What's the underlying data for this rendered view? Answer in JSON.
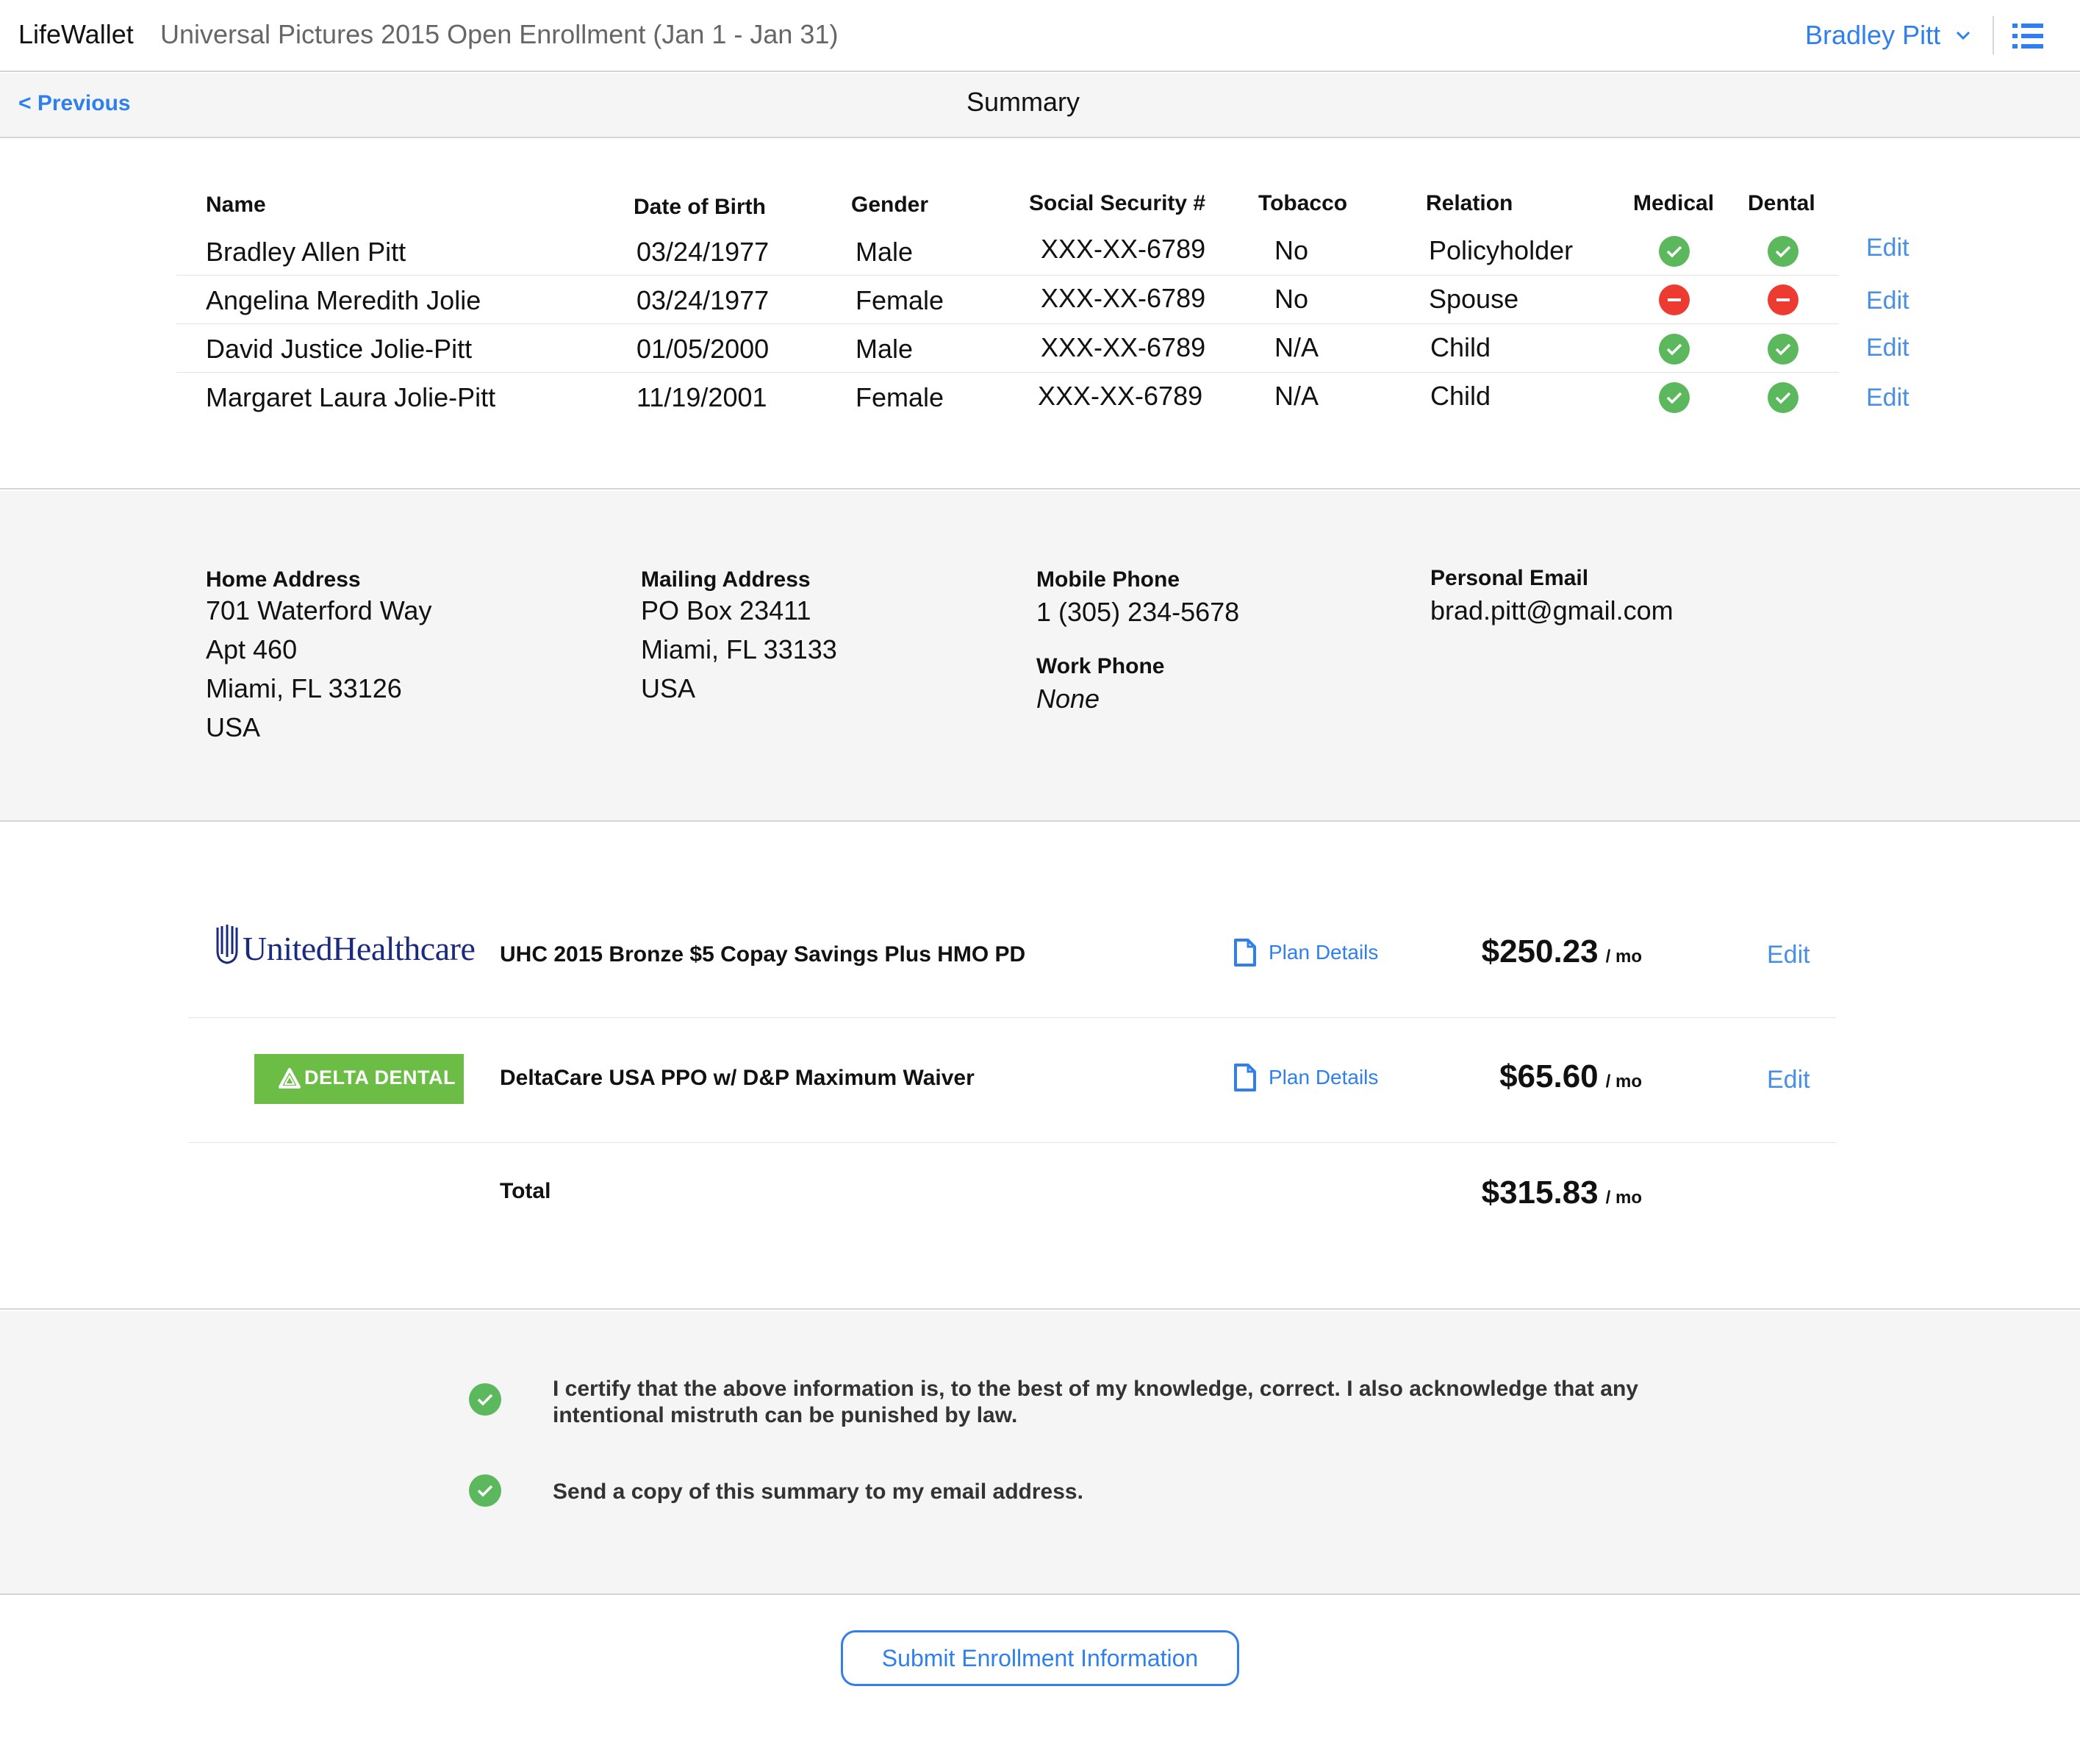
{
  "header": {
    "app_name": "LifeWallet",
    "enrollment_title": "Universal Pictures 2015 Open Enrollment (Jan 1 - Jan 31)",
    "user_name": "Bradley Pitt",
    "icons": [
      "chevron-down-icon",
      "list-menu-icon"
    ]
  },
  "nav": {
    "previous_label": "< Previous",
    "page_title": "Summary"
  },
  "family": {
    "columns": [
      "Name",
      "Date of Birth",
      "Gender",
      "Social Security #",
      "Tobacco",
      "Relation",
      "Medical",
      "Dental"
    ],
    "edit_label": "Edit",
    "members": [
      {
        "name": "Bradley Allen Pitt",
        "dob": "03/24/1977",
        "gender": "Male",
        "ssn": "XXX-XX-6789",
        "tobacco": "No",
        "relation": "Policyholder",
        "medical": "enrolled",
        "dental": "enrolled"
      },
      {
        "name": "Angelina Meredith Jolie",
        "dob": "03/24/1977",
        "gender": "Female",
        "ssn": "XXX-XX-6789",
        "tobacco": "No",
        "relation": "Spouse",
        "medical": "declined",
        "dental": "declined"
      },
      {
        "name": "David Justice Jolie-Pitt",
        "dob": "01/05/2000",
        "gender": "Male",
        "ssn": "XXX-XX-6789",
        "tobacco": "N/A",
        "relation": "Child",
        "medical": "enrolled",
        "dental": "enrolled"
      },
      {
        "name": "Margaret Laura Jolie-Pitt",
        "dob": "11/19/2001",
        "gender": "Female",
        "ssn": "XXX-XX-6789",
        "tobacco": "N/A",
        "relation": "Child",
        "medical": "enrolled",
        "dental": "enrolled"
      }
    ],
    "status_colors": {
      "enrolled": "#5cb85c",
      "declined": "#ee3b32"
    }
  },
  "contact": {
    "home_address": {
      "label": "Home Address",
      "lines": [
        "701 Waterford Way",
        "Apt 460",
        "Miami, FL 33126",
        "USA"
      ]
    },
    "mailing_address": {
      "label": "Mailing Address",
      "lines": [
        "PO Box 23411",
        "Miami, FL 33133",
        "USA"
      ]
    },
    "mobile_phone": {
      "label": "Mobile Phone",
      "value": "1 (305) 234-5678"
    },
    "work_phone": {
      "label": "Work Phone",
      "value": "None"
    },
    "personal_email": {
      "label": "Personal Email",
      "value": "brad.pitt@gmail.com"
    }
  },
  "plans": {
    "items": [
      {
        "carrier": "UnitedHealthcare",
        "name": "UHC 2015 Bronze $5 Copay Savings Plus HMO PD",
        "details_label": "Plan Details",
        "price": "$250.23",
        "per": "/ mo",
        "edit_label": "Edit"
      },
      {
        "carrier": "DELTA DENTAL",
        "name": "DeltaCare USA PPO w/ D&P Maximum Waiver",
        "details_label": "Plan Details",
        "price": "$65.60",
        "per": "/ mo",
        "edit_label": "Edit"
      }
    ],
    "total_label": "Total",
    "total_price": "$315.83",
    "total_per": "/ mo",
    "brand_colors": {
      "uhc": "#1a2a7c",
      "delta": "#6cbd45"
    }
  },
  "certifications": [
    {
      "text": "I certify that the above information is, to the best of my knowledge, correct. I also acknowledge that any intentional mistruth can be punished by law.",
      "checked": true
    },
    {
      "text": "Send a copy of this summary to my email address.",
      "checked": true
    }
  ],
  "submit_label": "Submit Enrollment Information",
  "colors": {
    "accent": "#2f80ed",
    "success": "#5cb85c",
    "error": "#ee3b32"
  }
}
